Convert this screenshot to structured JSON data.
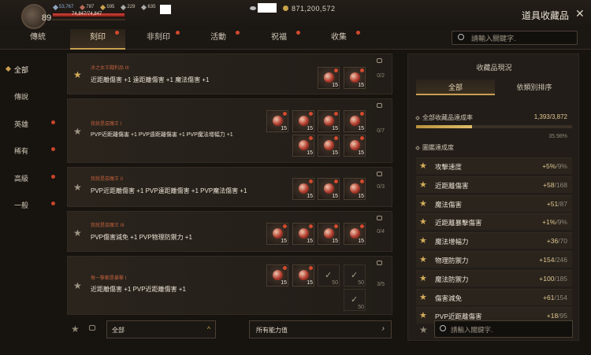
{
  "header": {
    "level": "89",
    "stats": [
      {
        "icon": "blue-crystal-icon",
        "value": "53,767"
      },
      {
        "icon": "red-crystal-icon",
        "value": "787"
      },
      {
        "icon": "gold-crystal-icon",
        "value": "595"
      },
      {
        "icon": "sword-icon",
        "value": "229"
      },
      {
        "icon": "silver-icon",
        "value": "635"
      }
    ],
    "hp_text": "74,847/74,847",
    "gold": "871,200,572",
    "title": "道具收藏品",
    "close": "✕"
  },
  "tabs": [
    {
      "label": "傳統",
      "dot": false,
      "active": false
    },
    {
      "label": "刻印",
      "dot": true,
      "active": true
    },
    {
      "label": "非刻印",
      "dot": true,
      "active": false
    },
    {
      "label": "活動",
      "dot": true,
      "active": false
    },
    {
      "label": "祝福",
      "dot": true,
      "active": false
    },
    {
      "label": "收集",
      "dot": true,
      "active": false
    }
  ],
  "search": {
    "placeholder": "請輸入關鍵字."
  },
  "sidebar": [
    {
      "label": "全部",
      "active": true,
      "dot": false
    },
    {
      "label": "傳說",
      "active": false,
      "dot": false
    },
    {
      "label": "英雄",
      "active": false,
      "dot": true
    },
    {
      "label": "稀有",
      "active": false,
      "dot": true
    },
    {
      "label": "高級",
      "active": false,
      "dot": true
    },
    {
      "label": "一般",
      "active": false,
      "dot": true
    }
  ],
  "rows": [
    {
      "subtitle": "冰之女王戰利品 III",
      "text": "近距離傷害 +1 遠距離傷害 +1 魔法傷害 +1",
      "count": "0/2",
      "gold_star": true
    },
    {
      "subtitle": "我就是惡魔王 I",
      "text": "PVP近距離傷害 +1 PVP遠距離傷害 +1 PVP魔法增幅力 +1",
      "count": "0/7",
      "gold_star": false
    },
    {
      "subtitle": "我就是惡魔王 II",
      "text": "PVP近距離傷害 +1 PVP遠距離傷害 +1 PVP魔法傷害 +1",
      "count": "0/3",
      "gold_star": false
    },
    {
      "subtitle": "我就是惡魔王 III",
      "text": "PVP傷害減免 +1 PVP物理防禦力 +1",
      "count": "0/4",
      "gold_star": false
    },
    {
      "subtitle": "每一擊都是暴擊 I",
      "text": "近距離傷害 +1 PVP近距離傷害 +1",
      "count": "3/5",
      "gold_star": false
    }
  ],
  "slot_labels": {
    "q15": "15",
    "q50": "50",
    "check": "✓"
  },
  "filters": {
    "grade": "全部",
    "grade_caret": "^",
    "ability": "所有能力值",
    "ability_caret": "›"
  },
  "panel": {
    "title": "收藏品現況",
    "tabs": [
      "全部",
      "依類別排序"
    ],
    "section1": "全部收藏品達成率",
    "progress": "1,393/3,872",
    "progress_fraction": 0.36,
    "percent": "35.98%",
    "section2": "圖鑑達成度",
    "stats": [
      {
        "name": "攻擊速度",
        "value": "+5%",
        "max": "/9%"
      },
      {
        "name": "近距離傷害",
        "value": "+58",
        "max": "/168"
      },
      {
        "name": "魔法傷害",
        "value": "+51",
        "max": "/87"
      },
      {
        "name": "近距離暴擊傷害",
        "value": "+1%",
        "max": "/9%"
      },
      {
        "name": "魔法增幅力",
        "value": "+36",
        "max": "/70"
      },
      {
        "name": "物理防禦力",
        "value": "+154",
        "max": "/246"
      },
      {
        "name": "魔法防禦力",
        "value": "+100",
        "max": "/185"
      },
      {
        "name": "傷害減免",
        "value": "+61",
        "max": "/154"
      },
      {
        "name": "PVP近距離傷害",
        "value": "+18",
        "max": "/95"
      }
    ],
    "search_placeholder": "請輸入關鍵字."
  }
}
